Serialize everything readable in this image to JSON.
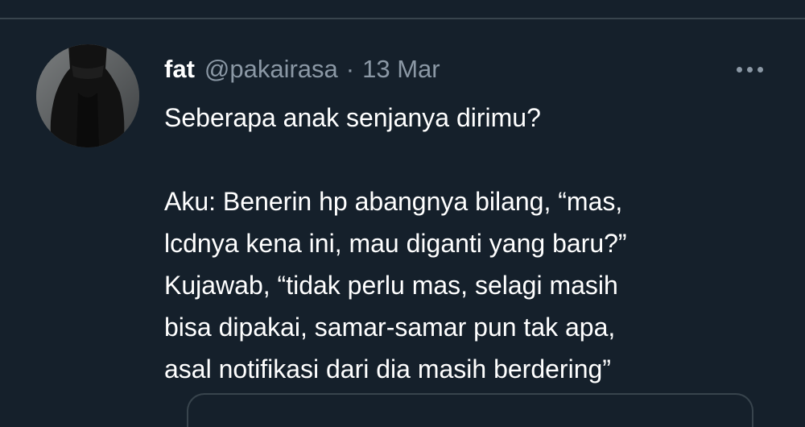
{
  "tweet": {
    "display_name": "fat",
    "handle": "@pakairasa",
    "separator": "·",
    "date": "13 Mar",
    "more_icon": "more-horizontal-icon",
    "lines": [
      "Seberapa anak senjanya dirimu?",
      "",
      "Aku: Benerin hp abangnya bilang, “mas,",
      "lcdnya kena ini, mau diganti yang baru?”",
      "Kujawab, “tidak perlu mas, selagi masih",
      "bisa dipakai, samar-samar pun tak apa,",
      "asal notifikasi dari dia masih berdering”"
    ]
  },
  "colors": {
    "background": "#15202b",
    "text_primary": "#ffffff",
    "text_secondary": "#8b98a5",
    "divider": "#38444d"
  }
}
